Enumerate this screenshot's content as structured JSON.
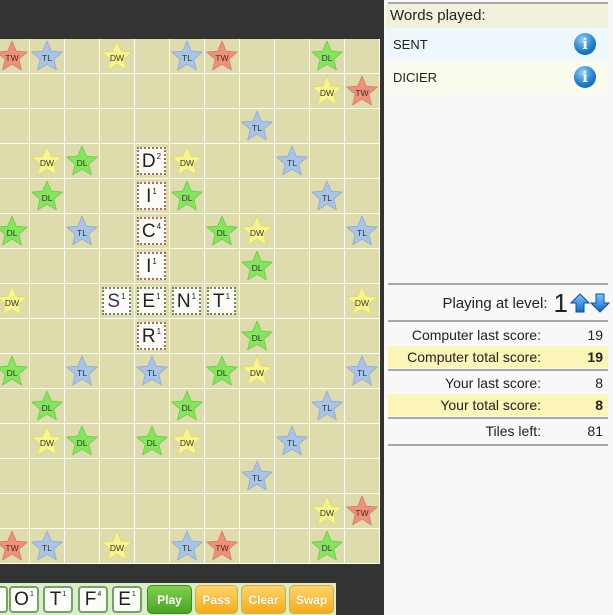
{
  "colors": {
    "board_bg": "#dedcad",
    "TW": "#f0907a",
    "TL": "#a8c4e8",
    "DW": "#f8f48e",
    "DL": "#84e65c",
    "computer_tile_border": "#b06a5e",
    "player_tile_border": "#6d8a5a",
    "highlight_row": "#fbf5b8"
  },
  "bonus_labels": {
    "TW": "TW",
    "TL": "TL",
    "DW": "DW",
    "DL": "DL"
  },
  "board": {
    "visible_rows": 15,
    "visible_cols": 11,
    "bonuses": [
      {
        "r": 0,
        "c": 0,
        "t": "TW"
      },
      {
        "r": 0,
        "c": 1,
        "t": "TL"
      },
      {
        "r": 0,
        "c": 3,
        "t": "DW"
      },
      {
        "r": 0,
        "c": 5,
        "t": "TL"
      },
      {
        "r": 0,
        "c": 6,
        "t": "TW"
      },
      {
        "r": 0,
        "c": 9,
        "t": "DL"
      },
      {
        "r": 1,
        "c": 9,
        "t": "DW"
      },
      {
        "r": 1,
        "c": 10,
        "t": "TW"
      },
      {
        "r": 2,
        "c": 7,
        "t": "TL"
      },
      {
        "r": 3,
        "c": 1,
        "t": "DW"
      },
      {
        "r": 3,
        "c": 2,
        "t": "DL"
      },
      {
        "r": 3,
        "c": 5,
        "t": "DW"
      },
      {
        "r": 3,
        "c": 8,
        "t": "TL"
      },
      {
        "r": 4,
        "c": 1,
        "t": "DL"
      },
      {
        "r": 4,
        "c": 5,
        "t": "DL"
      },
      {
        "r": 4,
        "c": 9,
        "t": "TL"
      },
      {
        "r": 5,
        "c": 0,
        "t": "DL"
      },
      {
        "r": 5,
        "c": 2,
        "t": "TL"
      },
      {
        "r": 5,
        "c": 6,
        "t": "DL"
      },
      {
        "r": 5,
        "c": 7,
        "t": "DW"
      },
      {
        "r": 5,
        "c": 10,
        "t": "TL"
      },
      {
        "r": 6,
        "c": 7,
        "t": "DL"
      },
      {
        "r": 7,
        "c": 0,
        "t": "DW"
      },
      {
        "r": 7,
        "c": 10,
        "t": "DW"
      },
      {
        "r": 8,
        "c": 7,
        "t": "DL"
      },
      {
        "r": 9,
        "c": 0,
        "t": "DL"
      },
      {
        "r": 9,
        "c": 2,
        "t": "TL"
      },
      {
        "r": 9,
        "c": 4,
        "t": "TL"
      },
      {
        "r": 9,
        "c": 6,
        "t": "DL"
      },
      {
        "r": 9,
        "c": 7,
        "t": "DW"
      },
      {
        "r": 9,
        "c": 10,
        "t": "TL"
      },
      {
        "r": 10,
        "c": 1,
        "t": "DL"
      },
      {
        "r": 10,
        "c": 5,
        "t": "DL"
      },
      {
        "r": 10,
        "c": 9,
        "t": "TL"
      },
      {
        "r": 11,
        "c": 1,
        "t": "DW"
      },
      {
        "r": 11,
        "c": 2,
        "t": "DL"
      },
      {
        "r": 11,
        "c": 4,
        "t": "DL"
      },
      {
        "r": 11,
        "c": 5,
        "t": "DW"
      },
      {
        "r": 11,
        "c": 8,
        "t": "TL"
      },
      {
        "r": 12,
        "c": 7,
        "t": "TL"
      },
      {
        "r": 13,
        "c": 9,
        "t": "DW"
      },
      {
        "r": 13,
        "c": 10,
        "t": "TW"
      },
      {
        "r": 14,
        "c": 0,
        "t": "TW"
      },
      {
        "r": 14,
        "c": 1,
        "t": "TL"
      },
      {
        "r": 14,
        "c": 3,
        "t": "DW"
      },
      {
        "r": 14,
        "c": 5,
        "t": "TL"
      },
      {
        "r": 14,
        "c": 6,
        "t": "TW"
      },
      {
        "r": 14,
        "c": 9,
        "t": "DL"
      }
    ],
    "tiles": [
      {
        "r": 3,
        "c": 4,
        "letter": "D",
        "points": "2",
        "owner": "computer"
      },
      {
        "r": 4,
        "c": 4,
        "letter": "I",
        "points": "1",
        "owner": "computer"
      },
      {
        "r": 5,
        "c": 4,
        "letter": "C",
        "points": "4",
        "owner": "computer"
      },
      {
        "r": 6,
        "c": 4,
        "letter": "I",
        "points": "1",
        "owner": "computer"
      },
      {
        "r": 7,
        "c": 4,
        "letter": "E",
        "points": "1",
        "owner": "player"
      },
      {
        "r": 8,
        "c": 4,
        "letter": "R",
        "points": "1",
        "owner": "computer"
      },
      {
        "r": 7,
        "c": 3,
        "letter": "S",
        "points": "1",
        "owner": "player",
        "special": true
      },
      {
        "r": 7,
        "c": 5,
        "letter": "N",
        "points": "1",
        "owner": "player"
      },
      {
        "r": 7,
        "c": 6,
        "letter": "T",
        "points": "1",
        "owner": "player"
      }
    ]
  },
  "rack": {
    "tiles": [
      {
        "letter": "",
        "points": ""
      },
      {
        "letter": "O",
        "points": "1"
      },
      {
        "letter": "T",
        "points": "1"
      },
      {
        "letter": "F",
        "points": "4"
      },
      {
        "letter": "E",
        "points": "1"
      }
    ],
    "buttons": {
      "play": "Play",
      "pass": "Pass",
      "clear": "Clear",
      "swap": "Swap"
    }
  },
  "panel": {
    "words_header": "Words played:",
    "words": [
      {
        "word": "SENT",
        "icon": "info-icon",
        "bg": "#eef8fc"
      },
      {
        "word": "DICIER",
        "icon": "info-icon",
        "bg": "#fbfbee"
      }
    ],
    "level_label": "Playing at level:",
    "level": "1",
    "level_up_icon": "arrow-up-icon",
    "level_down_icon": "arrow-down-icon",
    "scores": [
      {
        "label": "Computer last score:",
        "value": "19",
        "highlight": false
      },
      {
        "label": "Computer total score:",
        "value": "19",
        "highlight": true
      },
      {
        "label": "Your last score:",
        "value": "8",
        "highlight": false
      },
      {
        "label": "Your total score:",
        "value": "8",
        "highlight": true
      },
      {
        "label": "Tiles left:",
        "value": "81",
        "highlight": false
      }
    ]
  }
}
